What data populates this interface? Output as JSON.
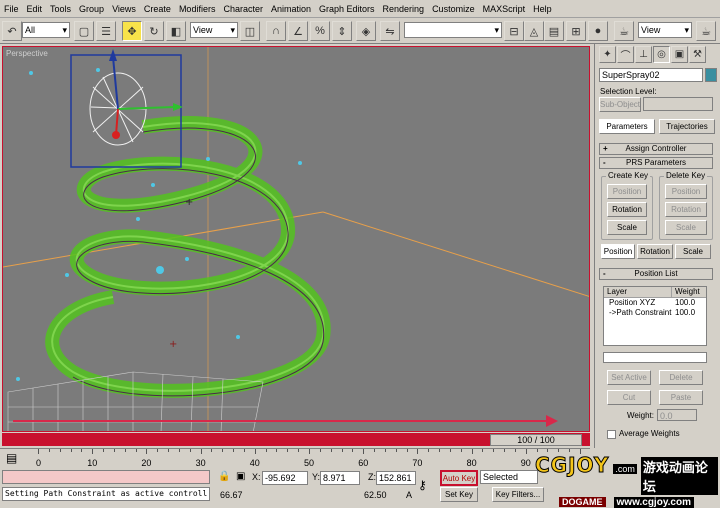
{
  "menu": [
    "File",
    "Edit",
    "Tools",
    "Group",
    "Views",
    "Create",
    "Modifiers",
    "Character",
    "Animation",
    "Graph Editors",
    "Rendering",
    "Customize",
    "MAXScript",
    "Help"
  ],
  "toolbar": {
    "selection_filter": "All",
    "ref_coord": "View",
    "right_view": "View",
    "named_selection": ""
  },
  "viewport": {
    "label": "Perspective"
  },
  "time": {
    "counter": "100 / 100",
    "ticks": [
      "0",
      "10",
      "20",
      "30",
      "40",
      "50",
      "60",
      "70",
      "80",
      "90"
    ]
  },
  "status": {
    "prompt_top": "",
    "prompt_bottom": "Setting Path Constraint as active controll",
    "x_label": "X:",
    "x_value": "-95.692",
    "y_label": "Y:",
    "y_value": "8.971",
    "z_label": "Z:",
    "z_value": "152.861",
    "frame_left": "66.67",
    "frame_right": "62.50",
    "a_label": "A",
    "auto_key": "Auto Key",
    "set_key": "Set Key",
    "selected": "Selected",
    "key_filters": "Key Filters..."
  },
  "command_panel": {
    "object_name": "SuperSpray02",
    "selection_level": "Selection Level:",
    "sub_object": "Sub-Object",
    "tab_parameters": "Parameters",
    "tab_trajectories": "Trajectories",
    "assign_controller": "Assign Controller",
    "prs_parameters": "PRS Parameters",
    "create_key": "Create Key",
    "delete_key": "Delete Key",
    "ck_position": "Position",
    "ck_rotation": "Rotation",
    "ck_scale": "Scale",
    "dk_position": "Position",
    "dk_rotation": "Rotation",
    "dk_scale": "Scale",
    "prs_position": "Position",
    "prs_rotation": "Rotation",
    "prs_scale": "Scale",
    "position_list": "Position List",
    "col_layer": "Layer",
    "col_weight": "Weight",
    "rows": [
      {
        "layer": "Position XYZ",
        "weight": "100.0"
      },
      {
        "layer": "->Path Constraint",
        "weight": "100.0"
      }
    ],
    "set_active": "Set Active",
    "delete": "Delete",
    "cut": "Cut",
    "paste": "Paste",
    "weight_label": "Weight:",
    "weight_value": "0.0",
    "average_weights": "Average Weights",
    "expand_sign": "+",
    "collapse_sign": "-"
  },
  "watermark": {
    "logo": "CGJOY",
    "dotcom": ".com",
    "cn_text": "游戏动画论坛",
    "url": "www.cgjoy.com",
    "bottom_logo": "DOGAME"
  },
  "colors": {
    "accent_red": "#c8102e",
    "viewport_bg": "#7b7b7b",
    "particle_green": "#54c31e",
    "selection_box": "#1f3a9e"
  }
}
